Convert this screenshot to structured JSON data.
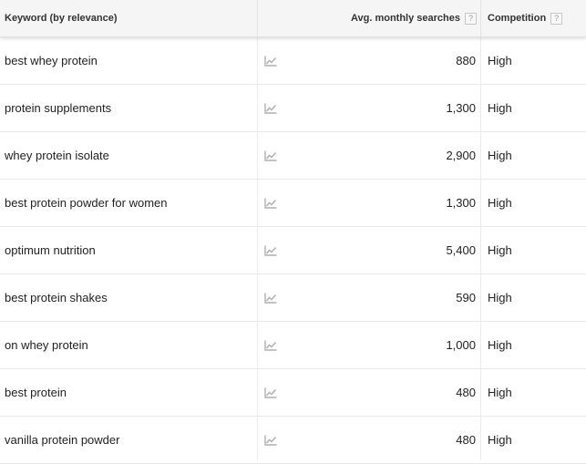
{
  "columns": {
    "keyword": "Keyword (by relevance)",
    "avg_monthly_searches": "Avg. monthly searches",
    "competition": "Competition",
    "help_glyph": "?"
  },
  "rows": [
    {
      "keyword": "best whey protein",
      "searches": "880",
      "competition": "High"
    },
    {
      "keyword": "protein supplements",
      "searches": "1,300",
      "competition": "High"
    },
    {
      "keyword": "whey protein isolate",
      "searches": "2,900",
      "competition": "High"
    },
    {
      "keyword": "best protein powder for women",
      "searches": "1,300",
      "competition": "High"
    },
    {
      "keyword": "optimum nutrition",
      "searches": "5,400",
      "competition": "High"
    },
    {
      "keyword": "best protein shakes",
      "searches": "590",
      "competition": "High"
    },
    {
      "keyword": "on whey protein",
      "searches": "1,000",
      "competition": "High"
    },
    {
      "keyword": "best protein",
      "searches": "480",
      "competition": "High"
    },
    {
      "keyword": "vanilla protein powder",
      "searches": "480",
      "competition": "High"
    }
  ],
  "icons": {
    "trend": "line-chart-icon",
    "help": "help-icon"
  },
  "colors": {
    "header_background": "#f5f5f5",
    "text": "#222222",
    "icon_gray": "#b0b0b0",
    "row_divider": "#e8e8e8"
  }
}
